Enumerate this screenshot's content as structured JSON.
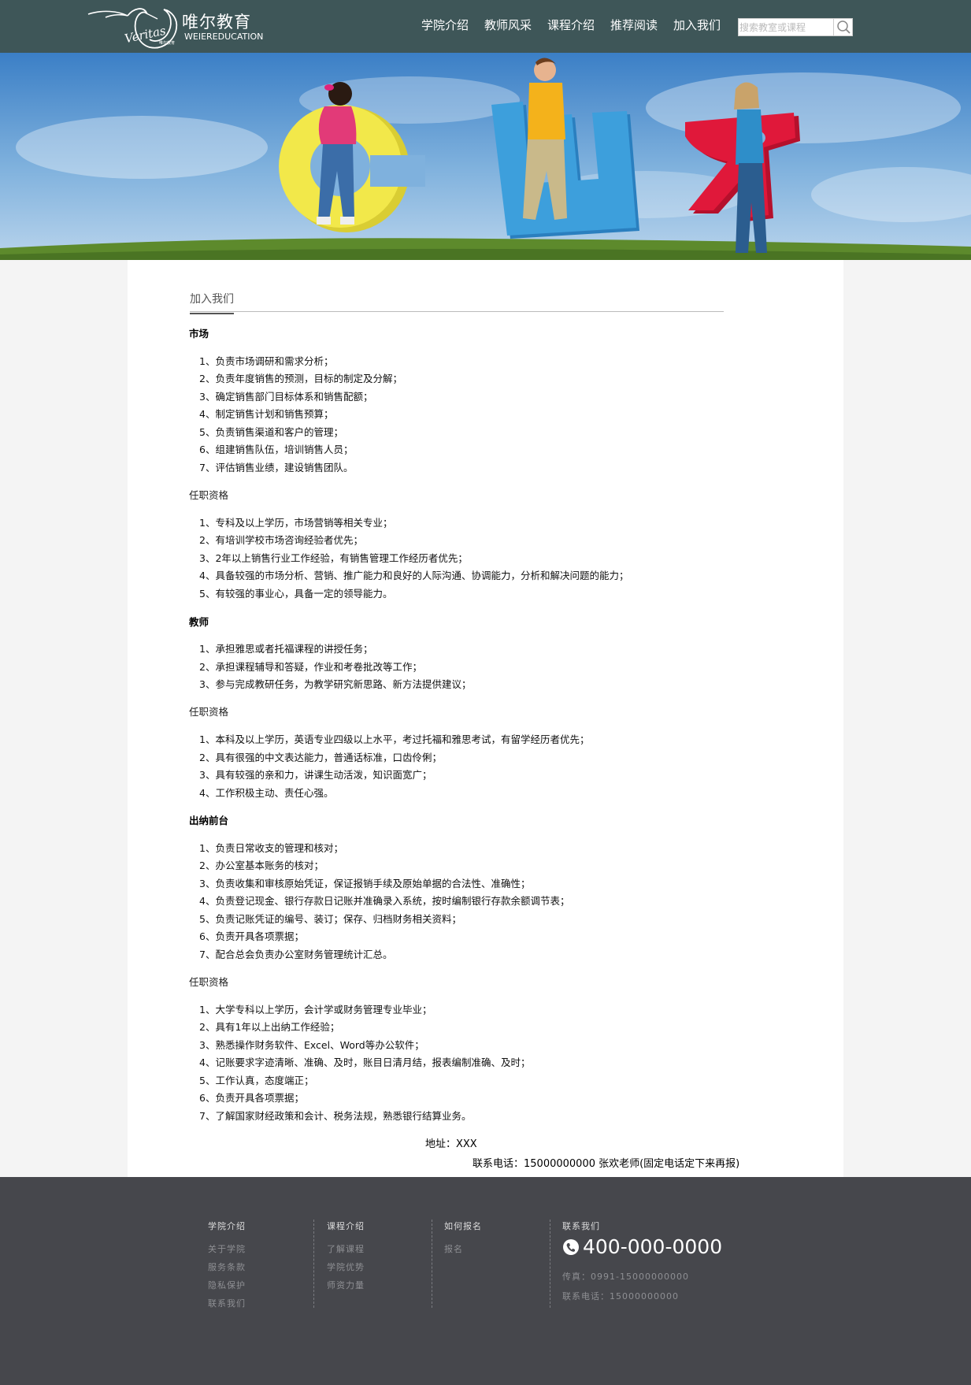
{
  "header": {
    "logo_cn": "唯尔教育",
    "logo_en": "WEIEREDUCATION",
    "logo_script": "Veritas",
    "nav": [
      "学院介绍",
      "教师风采",
      "课程介绍",
      "推荐阅读",
      "加入我们"
    ],
    "search_placeholder": "搜索教室或课程"
  },
  "main": {
    "section_title": "加入我们",
    "market": {
      "heading": "市场",
      "duties": [
        "1、负责市场调研和需求分析；",
        "2、负责年度销售的预测，目标的制定及分解；",
        "3、确定销售部门目标体系和销售配额；",
        "4、制定销售计划和销售预算；",
        "5、负责销售渠道和客户的管理；",
        "6、组建销售队伍，培训销售人员；",
        "7、评估销售业绩，建设销售团队。"
      ],
      "req_heading": "任职资格",
      "reqs": [
        "1、专科及以上学历，市场营销等相关专业；",
        "2、有培训学校市场咨询经验者优先；",
        "3、2年以上销售行业工作经验，有销售管理工作经历者优先；",
        "4、具备较强的市场分析、营销、推广能力和良好的人际沟通、协调能力，分析和解决问题的能力；",
        "5、有较强的事业心，具备一定的领导能力。"
      ]
    },
    "teacher": {
      "heading": "教师",
      "duties": [
        "1、承担雅思或者托福课程的讲授任务；",
        "2、承担课程辅导和答疑，作业和考卷批改等工作；",
        "3、参与完成教研任务，为教学研究新思路、新方法提供建议；"
      ],
      "req_heading": "任职资格",
      "reqs": [
        "1、本科及以上学历，英语专业四级以上水平，考过托福和雅思考试，有留学经历者优先；",
        "2、具有很强的中文表达能力，普通话标准，口齿伶俐；",
        "3、具有较强的亲和力，讲课生动活泼，知识面宽广；",
        "4、工作积极主动、责任心强。"
      ]
    },
    "cashier": {
      "heading": "出纳前台",
      "duties": [
        "1、负责日常收支的管理和核对；",
        "2、办公室基本账务的核对；",
        "3、负责收集和审核原始凭证，保证报销手续及原始单据的合法性、准确性；",
        "4、负责登记现金、银行存款日记账并准确录入系统，按时编制银行存款余额调节表；",
        "5、负责记账凭证的编号、装订；保存、归档财务相关资料；",
        "6、负责开具各项票据；",
        "7、配合总会负责办公室财务管理统计汇总。"
      ],
      "req_heading": "任职资格",
      "reqs": [
        "1、大学专科以上学历，会计学或财务管理专业毕业；",
        "2、具有1年以上出纳工作经验；",
        "3、熟悉操作财务软件、Excel、Word等办公软件；",
        "4、记账要求字迹清晰、准确、及时，账目日清月结，报表编制准确、及时；",
        "5、工作认真，态度端正；",
        "6、负责开具各项票据；",
        "7、了解国家财经政策和会计、税务法规，熟悉银行结算业务。"
      ]
    },
    "address": "地址：XXX",
    "contact": "联系电话：15000000000 张欢老师(固定电话定下来再报)"
  },
  "footer": {
    "col1": {
      "title": "学院介绍",
      "links": [
        "关于学院",
        "服务条款",
        "隐私保护",
        "联系我们"
      ]
    },
    "col2": {
      "title": "课程介绍",
      "links": [
        "了解课程",
        "学院优势",
        "师资力量"
      ]
    },
    "col3": {
      "title": "如何报名",
      "links": [
        "报名"
      ]
    },
    "col4": {
      "title": "联系我们",
      "phone": "400-000-0000",
      "fax": "传真：0991-15000000000",
      "tel": "联系电话：15000000000"
    }
  },
  "colors": {
    "header_bg": "#3e5658",
    "footer_bg": "#46474c",
    "page_bg": "#f4f4f4"
  },
  "icons": [
    "crane-logo-icon",
    "search-icon",
    "phone-icon"
  ],
  "banner": {
    "letters": [
      "О",
      "Ш",
      "Я"
    ],
    "letter_colors": [
      "#f2e84a",
      "#3d9fdc",
      "#e0183a"
    ]
  }
}
